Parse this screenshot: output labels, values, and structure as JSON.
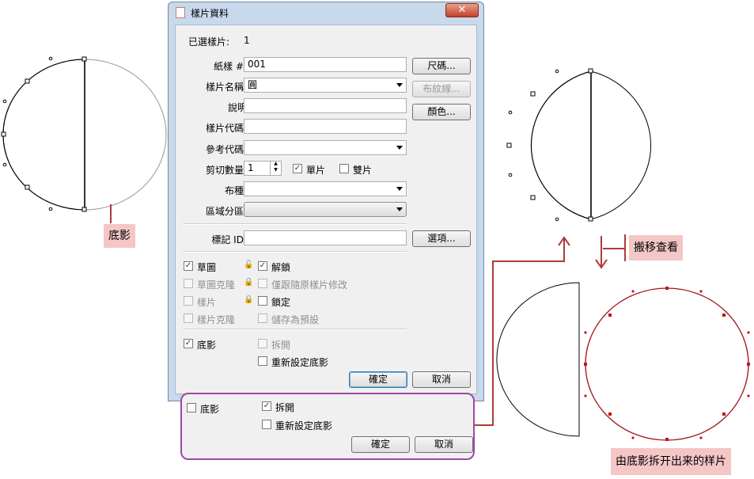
{
  "dialog": {
    "title": "樣片資料",
    "close_glyph": "✕",
    "selected_label": "已選樣片:",
    "selected_value": "1",
    "paper_label": "紙樣 #:",
    "paper_value": "001",
    "name_label": "樣片名稱:",
    "name_value": "圓",
    "desc_label": "說明",
    "code_label": "樣片代碼:",
    "ref_label": "參考代碼:",
    "cut_label": "剪切數量:",
    "cut_value": "1",
    "single_label": "單片",
    "double_label": "雙片",
    "fabric_label": "布種:",
    "region_label": "區域分區:",
    "mark_label": "標記 ID:",
    "btn_size": "尺碼...",
    "btn_grain": "布紋線...",
    "btn_color": "顏色...",
    "btn_options": "選項...",
    "draft_label": "草圖",
    "unlock_label": "解鎖",
    "draft_clone_label": "草圖克隆",
    "follow_label": "僅跟隨原樣片修改",
    "piece_label": "樣片",
    "lock_label": "鎖定",
    "piece_clone_label": "樣片克隆",
    "save_default_label": "儲存為預設",
    "shadow_label": "底影",
    "detach_label": "拆開",
    "reset_shadow_label": "重新設定底影",
    "ok": "確定",
    "cancel": "取消"
  },
  "panel": {
    "shadow_label": "底影",
    "detach_label": "拆開",
    "reset_shadow_label": "重新設定底影",
    "ok": "確定",
    "cancel": "取消"
  },
  "callouts": {
    "shadow": "底影",
    "move_view": "搬移查看",
    "detached_piece": "由底影拆开出来的样片"
  },
  "colors": {
    "accent_red": "#b03a3a",
    "accent_purple": "#9b4aa3",
    "callout_bg": "#f4c6c6"
  }
}
